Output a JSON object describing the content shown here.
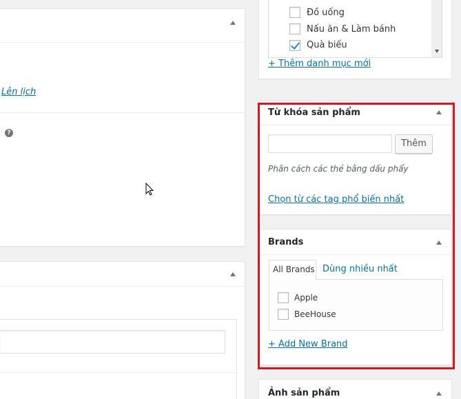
{
  "left_panel": {
    "schedule_link": "Lên lịch"
  },
  "categories": {
    "items": [
      {
        "label": "Đồ uống",
        "checked": false
      },
      {
        "label": "Nấu ăn & Làm bánh",
        "checked": false
      },
      {
        "label": "Quà biếu",
        "checked": true
      }
    ],
    "add_link": "+ Thêm danh mục mới"
  },
  "tags_box": {
    "title": "Từ khóa sản phẩm",
    "input_value": "",
    "add_button": "Thêm",
    "hint": "Phân cách các thẻ bằng dấu phẩy",
    "choose_link": "Chọn từ các tag phổ biến nhất"
  },
  "brands_box": {
    "title": "Brands",
    "tabs": [
      "All Brands",
      "Dùng nhiều nhất"
    ],
    "items": [
      {
        "label": "Apple",
        "checked": false
      },
      {
        "label": "BeeHouse",
        "checked": false
      }
    ],
    "add_link": "+ Add New Brand"
  },
  "image_box": {
    "title": "Ảnh sản phẩm"
  },
  "colors": {
    "link": "#0073aa",
    "highlight": "#e0141e",
    "check": "#1e8cbe"
  }
}
